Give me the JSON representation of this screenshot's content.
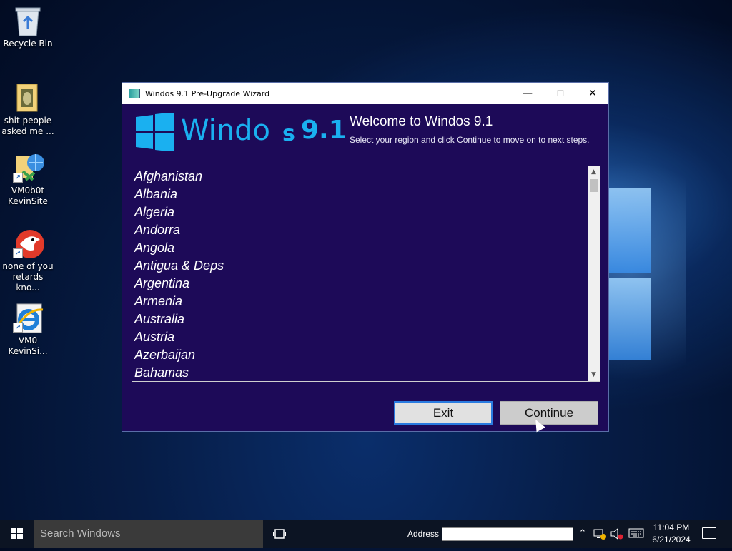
{
  "desktop": {
    "icons": [
      {
        "label": "Recycle Bin",
        "icon": "recycle-bin-icon"
      },
      {
        "label": "shit people asked me ...",
        "icon": "folder-icon"
      },
      {
        "label": "VM0b0t KevinSite",
        "icon": "web-shortcut-icon"
      },
      {
        "label": "none of you retards kno...",
        "icon": "dragon-app-icon"
      },
      {
        "label": "VM0 KevinSi...",
        "icon": "internet-explorer-icon"
      }
    ]
  },
  "window": {
    "title": "Windos 9.1 Pre-Upgrade Wizard",
    "controls": {
      "minimize": "—",
      "maximize": "☐",
      "close": "✕"
    },
    "logo": {
      "text": "Windo",
      "s": "s",
      "version": "9.1"
    },
    "heading": "Welcome to Windos 9.1",
    "subtitle": "Select your region and click Continue to move on to next steps.",
    "regions": [
      "Afghanistan",
      "Albania",
      "Algeria",
      "Andorra",
      "Angola",
      "Antigua & Deps",
      "Argentina",
      "Armenia",
      "Australia",
      "Austria",
      "Azerbaijan",
      "Bahamas"
    ],
    "buttons": {
      "exit": "Exit",
      "continue": "Continue"
    }
  },
  "taskbar": {
    "search_placeholder": "Search Windows",
    "address_label": "Address",
    "address_value": "",
    "clock_time": "11:04 PM",
    "clock_date": "6/21/2024"
  },
  "colors": {
    "window_bg": "#1d0a58",
    "logo": "#1ab0f0",
    "taskbar": "#0c1423"
  }
}
